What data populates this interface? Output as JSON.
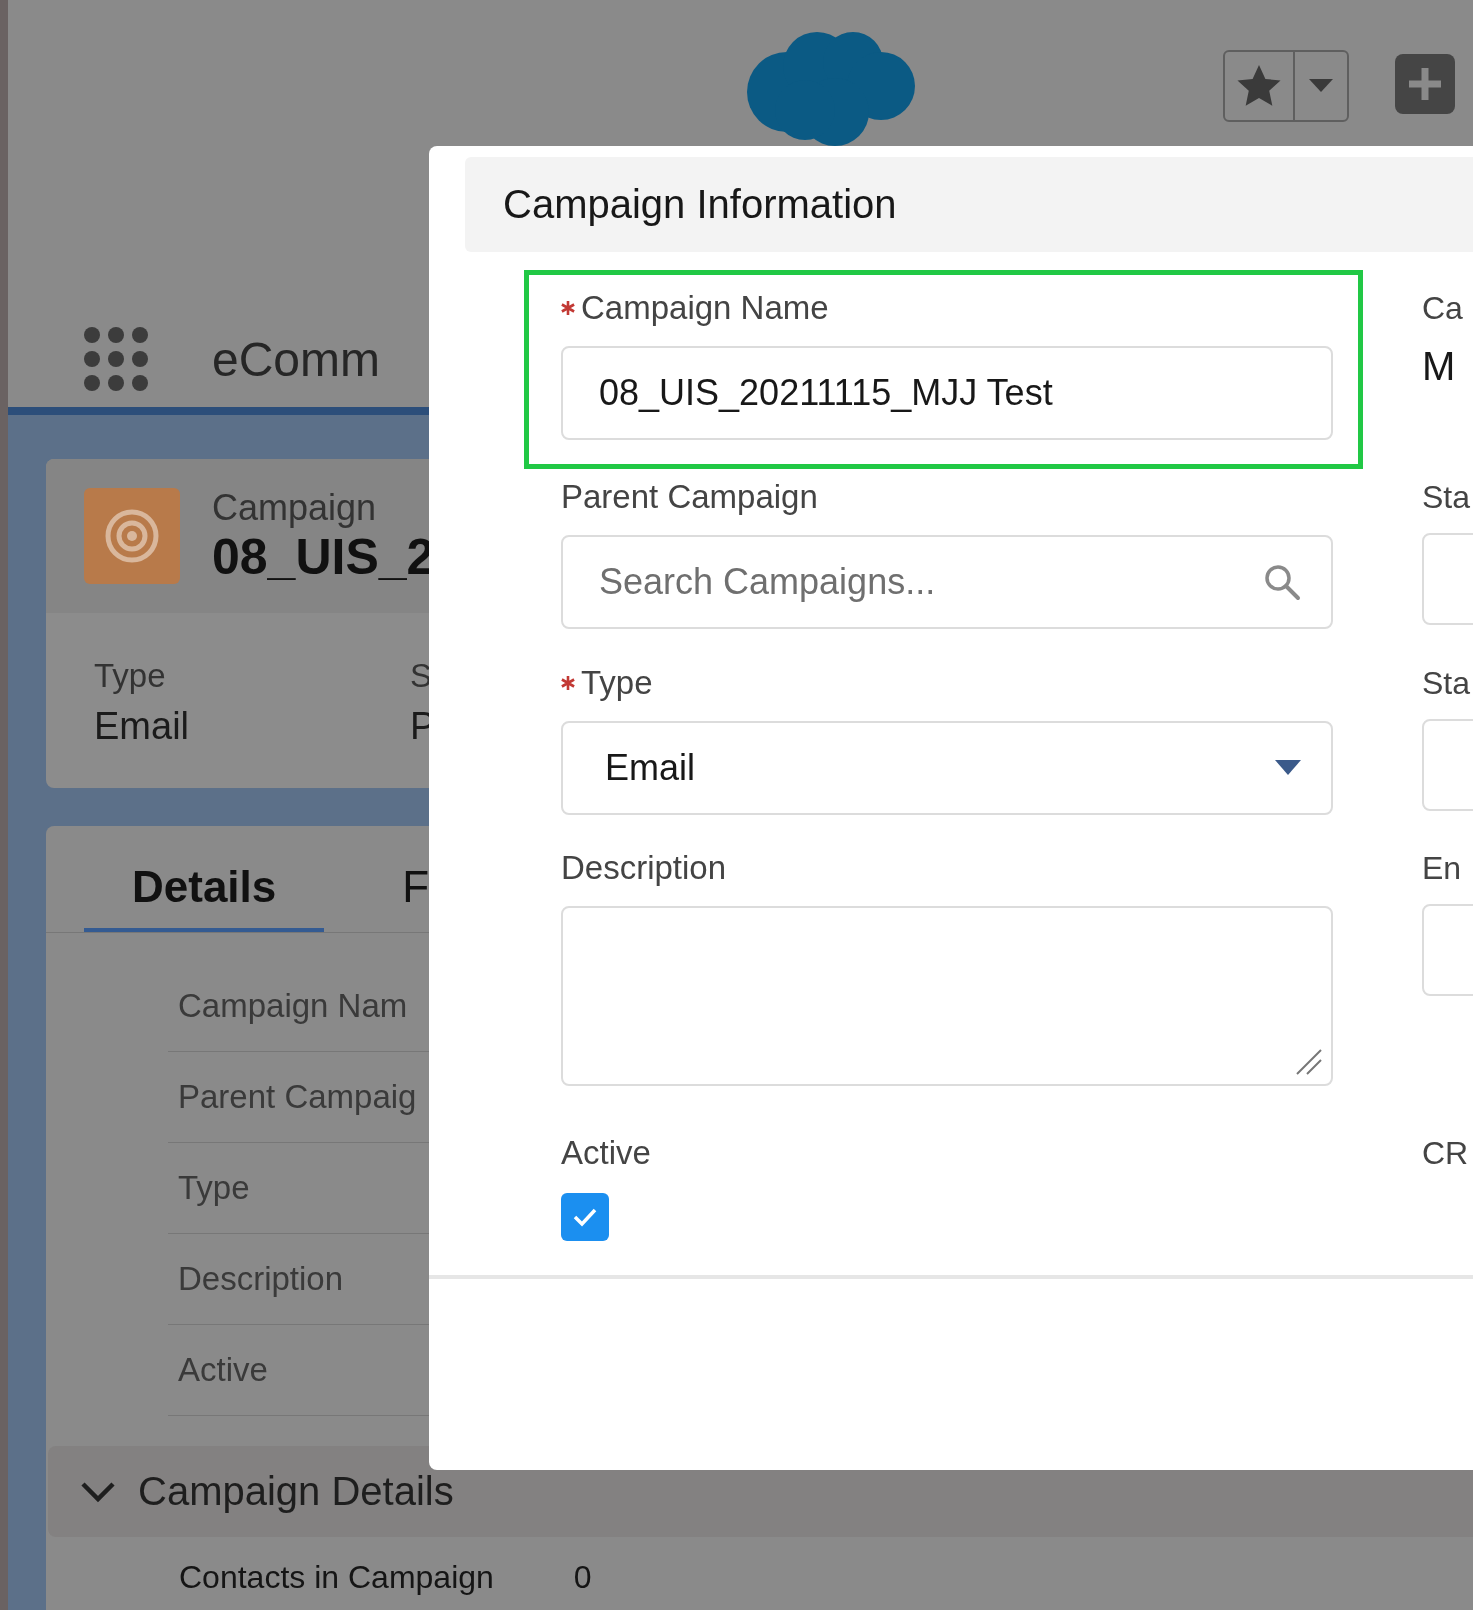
{
  "topbar": {
    "app_name": "eComm"
  },
  "record": {
    "object_label": "Campaign",
    "title": "08_UIS_2",
    "highlights": [
      {
        "label": "Type",
        "value": "Email"
      },
      {
        "label": "S",
        "value": "P"
      }
    ]
  },
  "tabs": [
    {
      "label": "Details",
      "selected": true
    },
    {
      "label": "F",
      "selected": false
    }
  ],
  "detail_rows": [
    "Campaign Nam",
    "Parent Campaig",
    "Type",
    "Description",
    "Active"
  ],
  "section": {
    "title": "Campaign Details",
    "expanded": true,
    "rows": [
      {
        "label": "Contacts in Campaign",
        "value": "0"
      }
    ]
  },
  "modal": {
    "section_title": "Campaign Information",
    "left_fields": [
      {
        "kind": "text",
        "label": "Campaign Name",
        "required": true,
        "highlighted": true,
        "value": "08_UIS_20211115_MJJ Test"
      },
      {
        "kind": "lookup",
        "label": "Parent Campaign",
        "required": false,
        "highlighted": false,
        "placeholder": "Search Campaigns..."
      },
      {
        "kind": "select",
        "label": "Type",
        "required": true,
        "highlighted": false,
        "value": "Email"
      },
      {
        "kind": "textarea",
        "label": "Description",
        "required": false,
        "highlighted": false
      },
      {
        "kind": "checkbox",
        "label": "Active",
        "required": false,
        "highlighted": false,
        "checked": true
      }
    ],
    "right_fields": [
      {
        "kind": "output",
        "label": "Ca",
        "value": "M"
      },
      {
        "kind": "input",
        "label": "Sta"
      },
      {
        "kind": "input",
        "label": "Sta"
      },
      {
        "kind": "input",
        "label": "En"
      },
      {
        "kind": "label",
        "label": "CR"
      }
    ]
  }
}
